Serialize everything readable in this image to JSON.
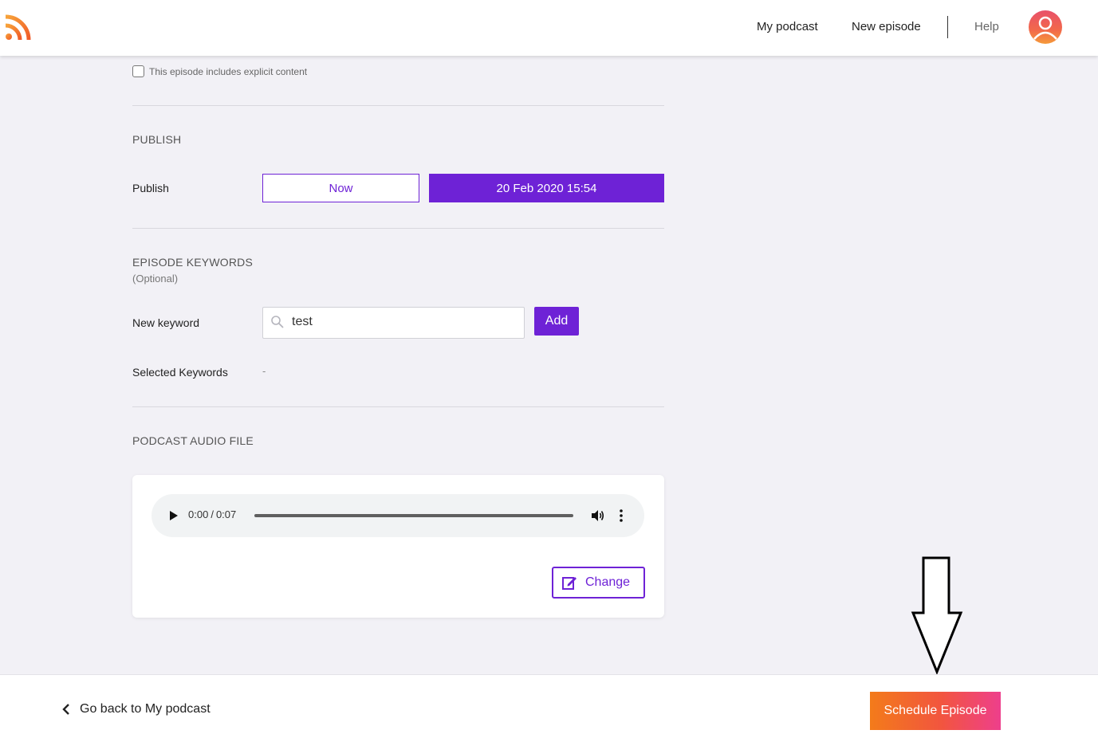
{
  "colors": {
    "accent": "#6e22d6",
    "background": "#f2f1f6",
    "cta_gradient_start": "#f37b1a",
    "cta_gradient_end": "#ee3f8c"
  },
  "header": {
    "logo_icon": "rss-icon",
    "nav": {
      "my_podcast": "My podcast",
      "new_episode": "New episode",
      "help": "Help"
    },
    "avatar_icon": "user-avatar-icon"
  },
  "explicit": {
    "label": "This episode includes explicit content",
    "checked": false
  },
  "publish": {
    "section_title": "PUBLISH",
    "label": "Publish",
    "now_label": "Now",
    "date_label": "20 Feb 2020 15:54"
  },
  "keywords": {
    "section_title": "EPISODE KEYWORDS",
    "section_subtitle": "(Optional)",
    "new_label": "New keyword",
    "input_value": "test",
    "add_label": "Add",
    "selected_label": "Selected Keywords",
    "selected_value": "-"
  },
  "audio": {
    "section_title": "PODCAST AUDIO FILE",
    "current_time": "0:00",
    "separator": "/",
    "duration": "0:07",
    "progress": 0,
    "change_label": "Change"
  },
  "footer": {
    "back_label": "Go back to My podcast",
    "schedule_label": "Schedule Episode"
  }
}
